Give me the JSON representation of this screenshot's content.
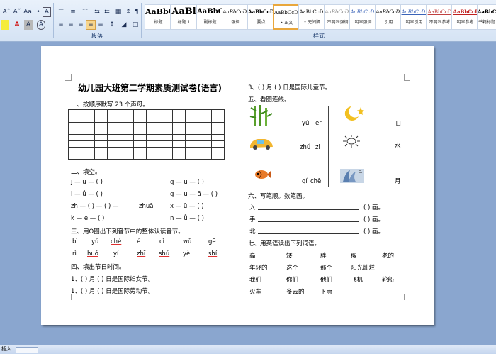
{
  "ribbon": {
    "font_tools": [
      "Aˆ",
      "Aˇ",
      "Aa",
      "•",
      "A"
    ],
    "para_tools": [
      "☰",
      "≡",
      "☷",
      "⇆",
      "⇇",
      "↕",
      "¶"
    ],
    "paragraph_label": "段落",
    "styles_label": "样式",
    "styles": [
      {
        "sample": "AaBbC",
        "name": "标题"
      },
      {
        "sample": "AaBl",
        "name": "标题 1"
      },
      {
        "sample": "AaBbC",
        "name": "副标题"
      },
      {
        "sample": "AaBbCcDı",
        "name": "强调"
      },
      {
        "sample": "AaBbCcD",
        "name": "要点"
      },
      {
        "sample": "AaBbCcDı",
        "name": "• 正文"
      },
      {
        "sample": "AaBbCcDı",
        "name": "• 无间隔"
      },
      {
        "sample": "AaBbCcDı",
        "name": "不明显强调"
      },
      {
        "sample": "AaBbCcDı",
        "name": "明显强调"
      },
      {
        "sample": "AaBbCcDı",
        "name": "引用"
      },
      {
        "sample": "AaBbCcDı",
        "name": "明显引用"
      },
      {
        "sample": "AaBbCcD",
        "name": "不明显参考"
      },
      {
        "sample": "AaBbCcI",
        "name": "明显参考"
      },
      {
        "sample": "AaBbCcD",
        "name": "书籍标题"
      }
    ]
  },
  "doc": {
    "title": "幼儿园大班第二学期素质测试卷(语言)",
    "s1": "一、按顺序默写 23 个声母。",
    "s2": "二、填空。",
    "fill": {
      "l1": "j — ü — (     )",
      "r1": "q — ü — (     )",
      "l2": "l — ǘ — (     )",
      "r2": "g — u — ā — (     )",
      "l3a": "zh — (     ) — (     ) —",
      "l3b": "zhuā",
      "r3": "x — ū — (     )",
      "l4": "k — e — (     )",
      "r4": "n — ǚ — (     )"
    },
    "s3": "三、用O圈出下列音节中的整体认读音节。",
    "syl_row1": [
      "bì",
      "yú",
      "ché",
      "é",
      "cì",
      "wǔ",
      "gē"
    ],
    "syl_row2": [
      "rì",
      "huǒ",
      "yí",
      "zhī",
      "shú",
      "yè",
      "shí"
    ],
    "s4": "四、填出节日时间。",
    "h1": "1、(     ) 月 (     ) 日是国际妇女节。",
    "h2": "1、(     ) 月 (     ) 日是国际劳动节。",
    "h3": "3、(     ) 月 (     ) 日是国际儿童节。",
    "s5": "五、看图连线。",
    "match_py": [
      {
        "a": "yú",
        "b": "er"
      },
      {
        "a": "zhú",
        "b": "zi"
      },
      {
        "a": "qí",
        "b": "chē"
      }
    ],
    "match_chars": [
      "日",
      "水",
      "月"
    ],
    "s6": "六、写笔顺。数笔画。",
    "strokes": [
      {
        "ch": "入",
        "tail": "(          ) 画。"
      },
      {
        "ch": "手",
        "tail": "(          ) 画。"
      },
      {
        "ch": "北",
        "tail": "(          ) 画。"
      }
    ],
    "s7": "七、用英语读出下列词语。",
    "words": [
      [
        "高",
        "矮",
        "胖",
        "瘦",
        "老的"
      ],
      [
        "年轻的",
        "这个",
        "那个",
        "阳光灿烂",
        ""
      ],
      [
        "我们",
        "你们",
        "他们",
        "飞机",
        "轮船"
      ],
      [
        "火车",
        "多云的",
        "下雨",
        "",
        ""
      ]
    ]
  },
  "status": {
    "mode": "插入"
  }
}
